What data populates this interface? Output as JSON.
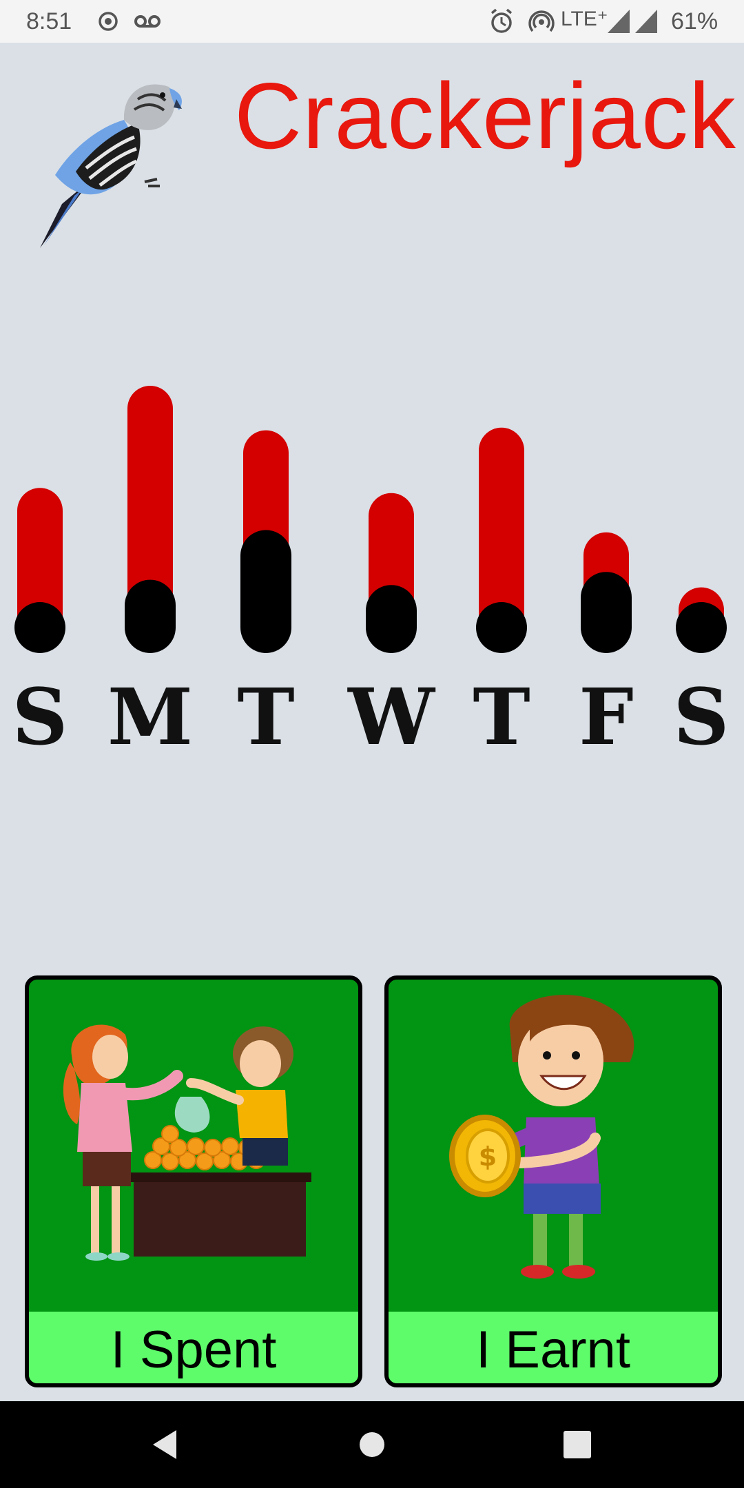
{
  "status_bar": {
    "time": "8:51",
    "network": "LTE⁺",
    "battery": "61%",
    "icons": [
      "record-icon",
      "voicemail-icon",
      "alarm-icon",
      "hotspot-icon",
      "signal-icon",
      "signal-icon",
      "battery-icon"
    ]
  },
  "app": {
    "title": "Crackerjack",
    "logo": "budgie-bird-icon"
  },
  "chart_data": {
    "type": "bar",
    "categories": [
      "S",
      "M",
      "T",
      "W",
      "T",
      "F",
      "S"
    ],
    "series": [
      {
        "values": [
          0.61,
          1.0,
          0.83,
          0.59,
          0.84,
          0.44,
          0.23
        ]
      },
      {
        "values": [
          0.08,
          0.28,
          0.47,
          0.26,
          0.09,
          0.31,
          0.13
        ]
      }
    ],
    "colors": [
      "#d40000",
      "#000000"
    ],
    "grid": false,
    "legend": "none"
  },
  "cards": [
    {
      "label": "I Spent",
      "illustration": "market-stall-illustration"
    },
    {
      "label": "I Earnt",
      "illustration": "boy-holding-coin-illustration"
    }
  ],
  "colors": {
    "background": "#dae0e6",
    "title": "#e8180e",
    "card": "#029413",
    "card_label": "#5efb6b"
  },
  "nav_bar": {
    "buttons": [
      "back-icon",
      "home-icon",
      "recents-icon"
    ]
  }
}
